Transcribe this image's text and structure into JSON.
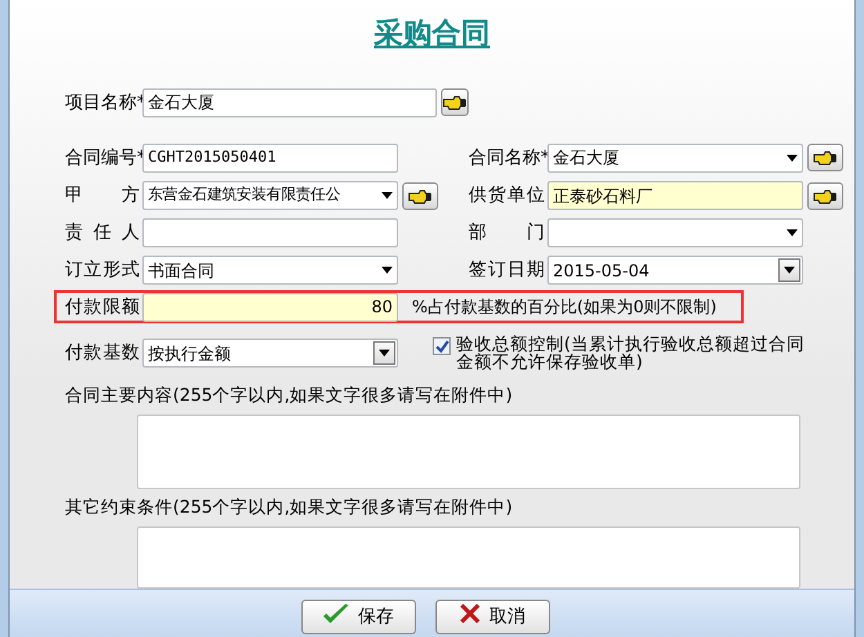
{
  "title": "采购合同",
  "rows": [
    {
      "left": {
        "kind": "text",
        "label": "项目名称*",
        "value": "金石大厦",
        "lookup_button": true
      }
    },
    {
      "left": {
        "kind": "text",
        "label": "合同编号*",
        "value": "CGHT2015050401"
      },
      "right": {
        "kind": "select",
        "label": "合同名称*",
        "value": "金石大厦",
        "lookup_button": true
      }
    },
    {
      "left": {
        "kind": "select",
        "label": "甲 方",
        "value": "东营金石建筑安装有限责任公",
        "lookup_button": true
      },
      "right": {
        "kind": "text",
        "label": "供货单位",
        "value": "正泰砂石料厂",
        "lookup_button": true,
        "highlighted": true
      }
    },
    {
      "left": {
        "kind": "text",
        "label": "责 任 人"
      },
      "right": {
        "kind": "select",
        "label": "部 门"
      }
    },
    {
      "left": {
        "kind": "select",
        "label": "订立形式",
        "value": "书面合同"
      },
      "right": {
        "kind": "date",
        "label": "签订日期",
        "value": "2015-05-04"
      }
    }
  ],
  "payment_limit": {
    "label": "付款限额",
    "value": "80",
    "note": "%占付款基数的百分比(如果为0则不限制)",
    "outlined": true,
    "highlighted": true
  },
  "payment_base": {
    "label": "付款基数",
    "value": "按执行金额"
  },
  "acceptance_control": {
    "label": "验收总额控制(当累计执行验收总额超过合同金额不允许保存验收单)",
    "checked": true
  },
  "text_areas": [
    {
      "label": "合同主要内容(255个字以内,如果文字很多请写在附件中)"
    },
    {
      "label": "其它约束条件(255个字以内,如果文字很多请写在附件中)"
    }
  ],
  "buttons": [
    {
      "kind": "save",
      "label": "保存"
    },
    {
      "kind": "cancel",
      "label": "取消"
    }
  ]
}
